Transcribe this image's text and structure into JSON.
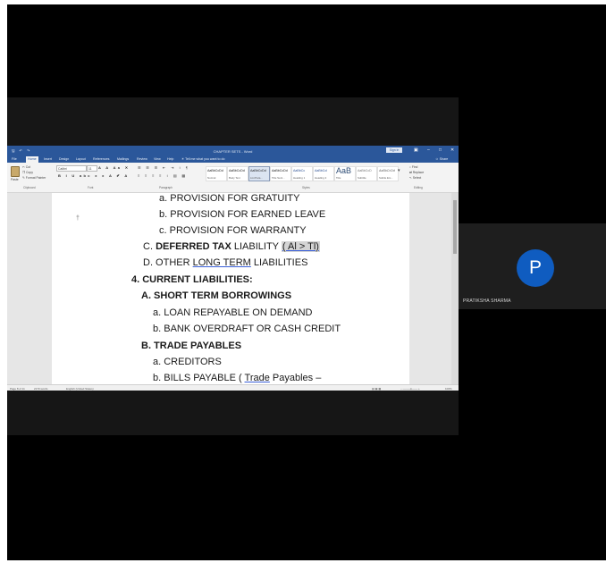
{
  "word": {
    "title": "CHAPTER SETS - Word",
    "signin_label": "Sign in",
    "tabs": [
      "File",
      "Home",
      "Insert",
      "Design",
      "Layout",
      "References",
      "Mailings",
      "Review",
      "View",
      "Help"
    ],
    "active_tab": "Home",
    "tell_me": "Tell me what you want to do",
    "share_label": "Share",
    "clipboard": {
      "paste": "Paste",
      "cut": "Cut",
      "copy": "Copy",
      "format_painter": "Format Painter",
      "label": "Clipboard"
    },
    "font": {
      "name": "Calibri",
      "size": "11",
      "label": "Font"
    },
    "paragraph_label": "Paragraph",
    "styles": [
      {
        "sample": "AaBbCcDd",
        "name": "Normal"
      },
      {
        "sample": "AaBbCcDd",
        "name": "Body Text"
      },
      {
        "sample": "AaBbCcDd",
        "name": "List Para..."
      },
      {
        "sample": "AaBbCcDd",
        "name": "Title Sent..."
      },
      {
        "sample": "AaBbCc",
        "name": "Heading 1"
      },
      {
        "sample": "AaBbCcI",
        "name": "Heading 2"
      },
      {
        "sample": "AaB",
        "name": "Title"
      },
      {
        "sample": "AaBbCcD",
        "name": "Subtitle"
      },
      {
        "sample": "AaBbCcDd",
        "name": "Subtle Em..."
      }
    ],
    "styles_label": "Styles",
    "editing": {
      "find": "Find",
      "replace": "Replace",
      "select": "Select",
      "label": "Editing"
    },
    "status": {
      "page": "Page 8 of 11",
      "words": "2170 words",
      "language": "English (United States)",
      "zoom": "100%"
    }
  },
  "document": {
    "lines": [
      {
        "text": "a. PROVISION FOR GRATUITY"
      },
      {
        "text": "b. PROVISION FOR EARNED LEAVE"
      },
      {
        "text": "c. PROVISION FOR WARRANTY"
      },
      {
        "prefix": "C. ",
        "bold": "DEFERRED TAX",
        "rest": " LIABILITY ",
        "highlight": "( Al > Tl)"
      },
      {
        "prefix": "D. OTHER ",
        "underlined": "LONG TERM",
        "rest": " LIABILITIES"
      },
      {
        "text": "4. CURRENT LIABILITIES:"
      },
      {
        "text": "A. SHORT TERM BORROWINGS"
      },
      {
        "text": "a. LOAN REPAYABLE ON DEMAND"
      },
      {
        "text": "b. BANK OVERDRAFT OR CASH CREDIT"
      },
      {
        "text": "B. TRADE PAYABLES"
      },
      {
        "text": "a. CREDITORS"
      },
      {
        "prefix": "b. BILLS PAYABLE ( ",
        "underlined": "Trade",
        "rest": " Payables –"
      }
    ]
  },
  "participant": {
    "initial": "P",
    "name": "PRATIKSHA SHARMA"
  },
  "colors": {
    "word_blue": "#2b579a",
    "avatar": "#0f5cc0",
    "background": "#000000"
  }
}
